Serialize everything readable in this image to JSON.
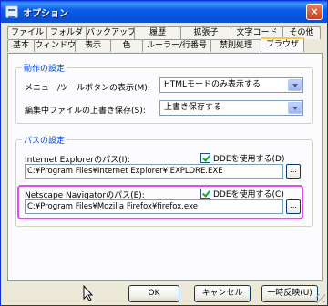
{
  "window": {
    "title": "オプション",
    "close_glyph": "×"
  },
  "tabs_row1": [
    "ファイル",
    "フォルダ",
    "バックアップ",
    "履歴",
    "拡張子",
    "文字コード",
    "その他"
  ],
  "tabs_row2": [
    "基本",
    "ウィンドウ",
    "表示",
    "色",
    "ルーラー/行番号",
    "禁則処理",
    "ブラウザ"
  ],
  "active_tab": "ブラウザ",
  "action_group": {
    "label": "動作の設定",
    "menu_display_label": "メニュー/ツールボタンの表示(M):",
    "menu_display_value": "HTMLモードのみ表示する",
    "overwrite_label": "編集中ファイルの上書き保存(S):",
    "overwrite_value": "上書き保存する"
  },
  "path_group": {
    "label": "パスの設定",
    "ie_label": "Internet Explorerのパス(I):",
    "ie_dde_label": "DDEを使用する(D)",
    "ie_path": "C:¥Program Files¥Internet Explorer¥IEXPLORE.EXE",
    "nn_label": "Netscape Navigatorのパス(E):",
    "nn_dde_label": "DDEを使用する(C)",
    "nn_path": "C:¥Program Files¥Mozilla Firefox¥firefox.exe",
    "browse_glyph": "..."
  },
  "buttons": {
    "ok": "OK",
    "cancel": "キャンセル",
    "apply": "一時反映(U)"
  },
  "colors": {
    "titlebar": "#0A5FE0",
    "group_label": "#0046D5",
    "highlight": "#E050E0",
    "dialog_bg": "#ECE9D8"
  }
}
